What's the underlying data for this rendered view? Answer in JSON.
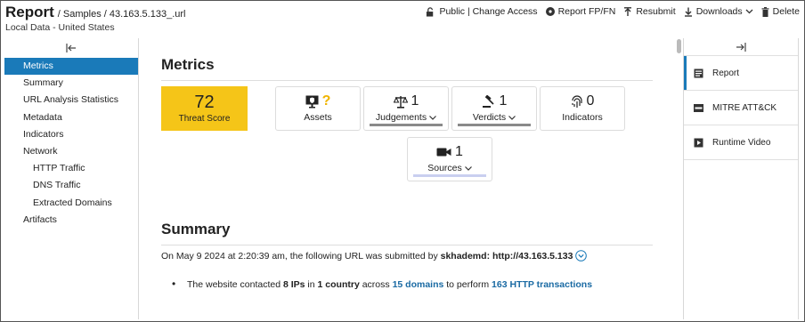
{
  "header": {
    "title": "Report",
    "breadcrumb": "/ Samples / 43.163.5.133_.url",
    "subtitle": "Local Data - United States",
    "actions": {
      "public": "Public | Change Access",
      "report_fp": "Report FP/FN",
      "resubmit": "Resubmit",
      "downloads": "Downloads",
      "delete": "Delete"
    }
  },
  "sidebar": {
    "items": [
      {
        "label": "Metrics",
        "active": true
      },
      {
        "label": "Summary"
      },
      {
        "label": "URL Analysis Statistics"
      },
      {
        "label": "Metadata"
      },
      {
        "label": "Indicators"
      },
      {
        "label": "Network"
      },
      {
        "label": "HTTP Traffic",
        "sub": true
      },
      {
        "label": "DNS Traffic",
        "sub": true
      },
      {
        "label": "Extracted Domains",
        "sub": true
      },
      {
        "label": "Artifacts"
      }
    ]
  },
  "metrics": {
    "heading": "Metrics",
    "threat_score": {
      "value": "72",
      "label": "Threat Score",
      "color": "#f5c518"
    },
    "cards": {
      "assets": {
        "value": "?",
        "label": "Assets",
        "icon": "monitor-shield-icon"
      },
      "judgements": {
        "value": "1",
        "label": "Judgements",
        "icon": "scales-icon"
      },
      "verdicts": {
        "value": "1",
        "label": "Verdicts",
        "icon": "gavel-icon"
      },
      "indicators": {
        "value": "0",
        "label": "Indicators",
        "icon": "fingerprint-icon"
      },
      "sources": {
        "value": "1",
        "label": "Sources",
        "icon": "camera-icon"
      }
    }
  },
  "summary": {
    "heading": "Summary",
    "line1": {
      "prefix": "On May 9 2024 at 2:20:39 am, the following URL was submitted by ",
      "user": "skhademd",
      "sep": ": ",
      "url": "http://43.163.5.133"
    },
    "bullet": {
      "t1": "The website contacted ",
      "ips": "8 IPs",
      "t2": " in ",
      "country": "1 country",
      "t3": " across ",
      "domains": "15 domains",
      "t4": " to perform ",
      "transactions": "163 HTTP transactions"
    }
  },
  "right_panel": {
    "items": [
      {
        "label": "Report",
        "icon": "report-icon",
        "active": true
      },
      {
        "label": "MITRE ATT&CK",
        "icon": "mitre-icon"
      },
      {
        "label": "Runtime Video",
        "icon": "play-icon"
      }
    ]
  },
  "colors": {
    "accent": "#1a7ab9",
    "link": "#1a6aa3",
    "score": "#f5c518",
    "question": "#f0b400"
  }
}
